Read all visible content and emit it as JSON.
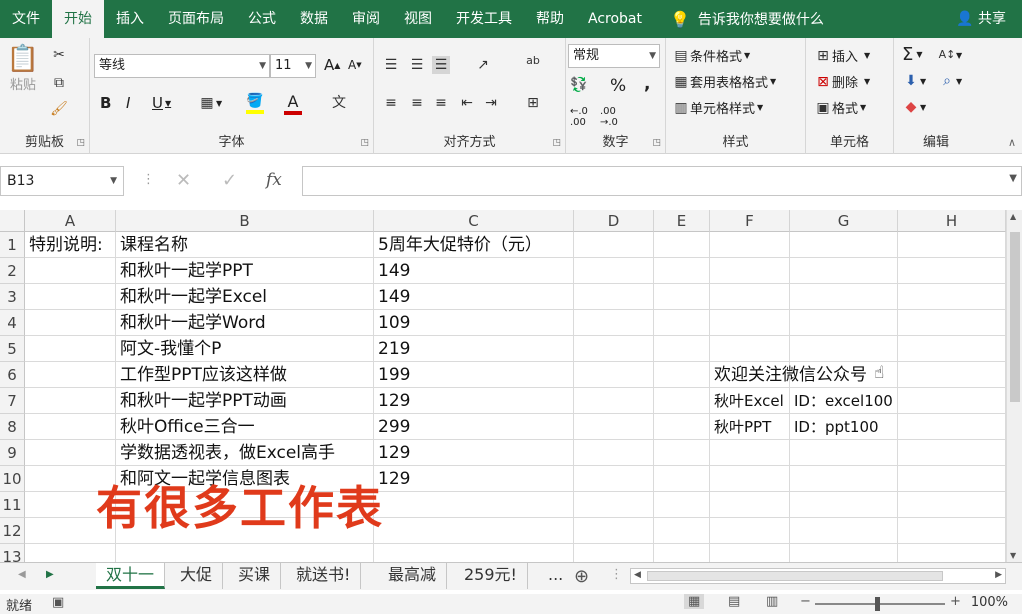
{
  "menu": {
    "tabs": [
      "文件",
      "开始",
      "插入",
      "页面布局",
      "公式",
      "数据",
      "审阅",
      "视图",
      "开发工具",
      "帮助",
      "Acrobat"
    ],
    "active_tab": "开始",
    "tell_me": "告诉我你想要做什么",
    "share": "共享"
  },
  "ribbon": {
    "clipboard": {
      "paste": "粘贴",
      "label": "剪贴板"
    },
    "font": {
      "name": "等线",
      "size": "11",
      "bold": "B",
      "italic": "I",
      "underline": "U",
      "grow": "A",
      "shrink": "A",
      "font_color": "A",
      "label": "字体"
    },
    "align": {
      "label": "对齐方式"
    },
    "number": {
      "format": "常规",
      "percent": "%",
      "comma": ",",
      "label": "数字"
    },
    "styles": {
      "cond": "条件格式",
      "table": "套用表格格式",
      "cell": "单元格样式",
      "label": "样式"
    },
    "cells": {
      "insert": "插入",
      "delete": "删除",
      "format": "格式",
      "label": "单元格"
    },
    "edit": {
      "sum": "Σ",
      "label": "编辑"
    }
  },
  "formula_bar": {
    "name_box": "B13",
    "fx": "fx",
    "value": ""
  },
  "columns": [
    "A",
    "B",
    "C",
    "D",
    "E",
    "F",
    "G",
    "H"
  ],
  "rows": [
    "1",
    "2",
    "3",
    "4",
    "5",
    "6",
    "7",
    "8",
    "9",
    "10",
    "11",
    "12",
    "13"
  ],
  "cells": {
    "A1": "特别说明:",
    "B1": "课程名称",
    "C1": "5周年大促特价（元）",
    "B2": "和秋叶一起学PPT",
    "C2": "149",
    "B3": "和秋叶一起学Excel",
    "C3": "149",
    "B4": "和秋叶一起学Word",
    "C4": "109",
    "B5": "阿文-我懂个P",
    "C5": "219",
    "B6": "工作型PPT应该这样做",
    "C6": "199",
    "B7": "和秋叶一起学PPT动画",
    "C7": "129",
    "B8": "秋叶Office三合一",
    "C8": "299",
    "B9": "学数据透视表，做Excel高手",
    "C9": "129",
    "B10": "和阿文一起学信息图表",
    "C10": "129",
    "F6": "欢迎关注微信公众号",
    "F7": "秋叶Excel",
    "G7": "ID：excel100",
    "F8": "秋叶PPT",
    "G8": "ID：ppt100"
  },
  "overlay_text": "有很多工作表",
  "sheets": [
    "双十一",
    "大促",
    "买课",
    "就送书!",
    "最高减",
    "259元!"
  ],
  "active_sheet": "双十一",
  "sheet_more": "...",
  "status": {
    "ready": "就绪",
    "zoom": "100%"
  },
  "colors": {
    "excel_green": "#217346",
    "overlay_red": "#e03a1b"
  }
}
